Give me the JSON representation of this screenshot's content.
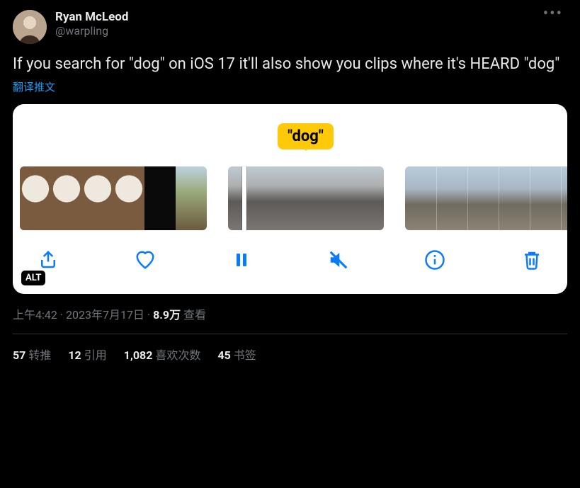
{
  "author": {
    "display_name": "Ryan McLeod",
    "handle": "@warpling"
  },
  "tweet_text": "If you search for \"dog\" on iOS 17 it'll also show you clips where it's HEARD \"dog\"",
  "translate_label": "翻译推文",
  "media": {
    "tooltip": "\"dog\"",
    "alt_badge": "ALT",
    "toolbar": {
      "share": "share",
      "like": "like",
      "pause": "pause",
      "mute": "mute",
      "info": "info",
      "delete": "delete"
    }
  },
  "meta": {
    "time": "上午4:42",
    "date": "2023年7月17日",
    "views_count": "8.9万",
    "views_label": "查看",
    "sep": " · "
  },
  "stats": {
    "retweets": {
      "count": "57",
      "label": "转推"
    },
    "quotes": {
      "count": "12",
      "label": "引用"
    },
    "likes": {
      "count": "1,082",
      "label": "喜欢次数"
    },
    "bookmarks": {
      "count": "45",
      "label": "书签"
    }
  }
}
